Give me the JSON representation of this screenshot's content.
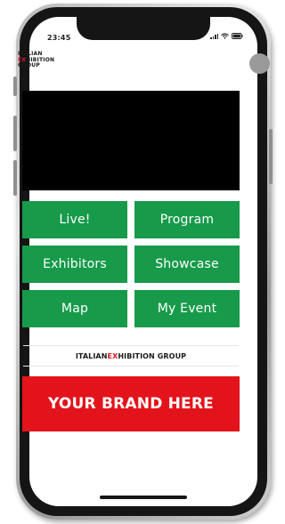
{
  "status_bar": {
    "time": "23:45"
  },
  "header": {
    "logo_lines": [
      "ITALIAN",
      "EXHIBITION",
      "GROUP"
    ],
    "logo_line2_first": "EX",
    "logo_line2_rest": "HIBITION"
  },
  "menu": {
    "items": [
      {
        "label": "Live!"
      },
      {
        "label": "Program"
      },
      {
        "label": "Exhibitors"
      },
      {
        "label": "Showcase"
      },
      {
        "label": "Map"
      },
      {
        "label": "My Event"
      }
    ]
  },
  "brand_strip": {
    "part1": "ITALIAN ",
    "part2": "EX",
    "part3": "HIBITION GROUP"
  },
  "ad_banner": {
    "label": "YOUR BRAND HERE"
  },
  "colors": {
    "menu_green": "#179a4a",
    "banner_red": "#e3131b",
    "accent_red": "#d61a2a",
    "hero_black": "#000000"
  },
  "icons": [
    "signal-icon",
    "wifi-icon",
    "battery-icon",
    "avatar"
  ]
}
